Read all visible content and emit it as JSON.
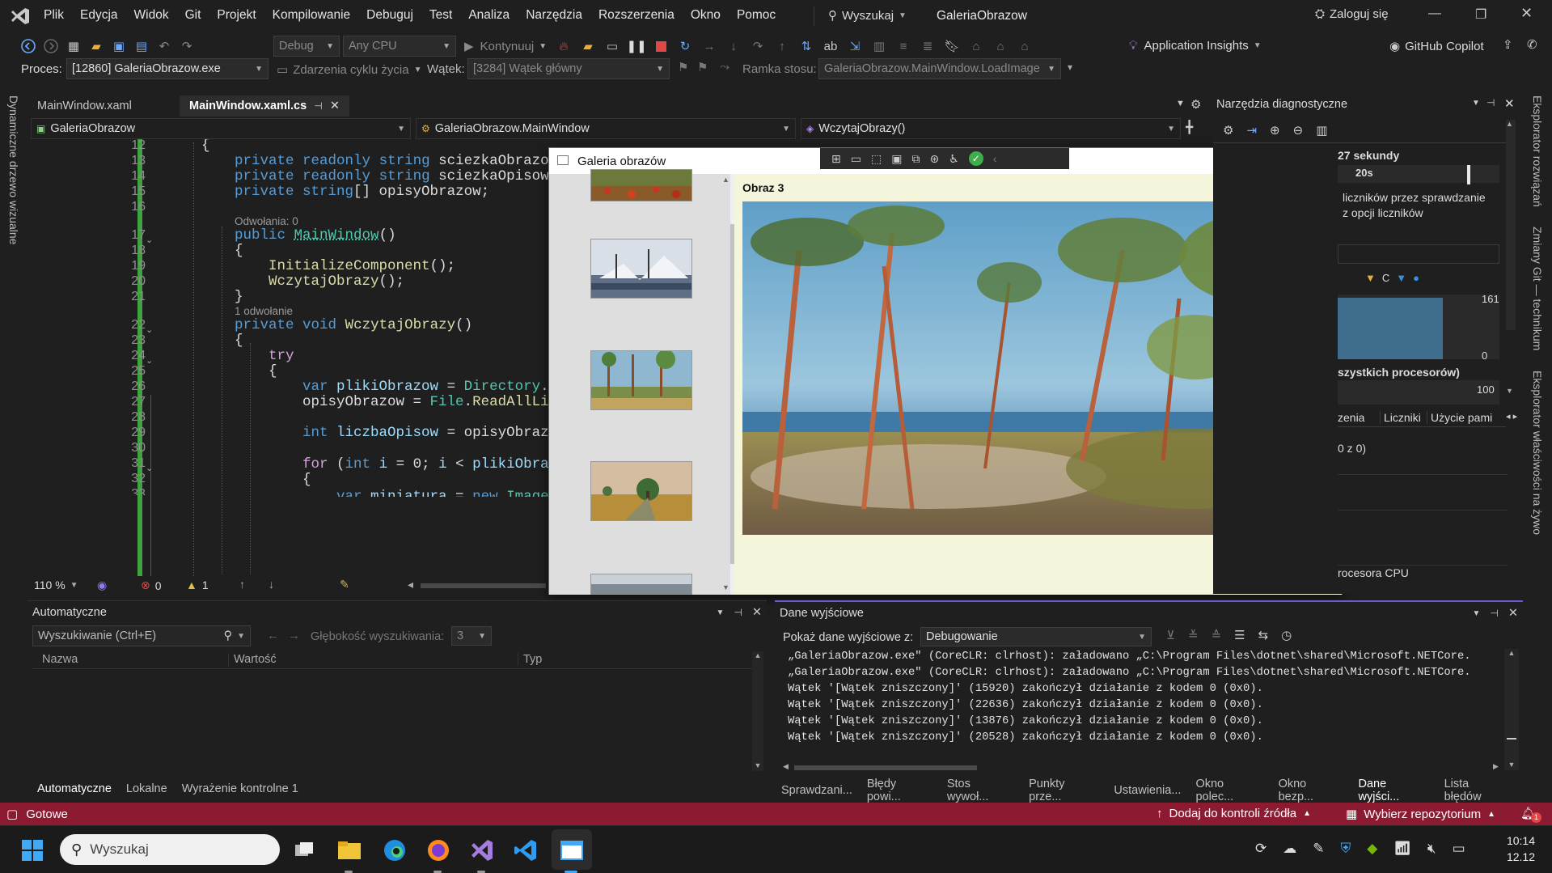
{
  "menu": {
    "items": [
      "Plik",
      "Edycja",
      "Widok",
      "Git",
      "Projekt",
      "Kompilowanie",
      "Debuguj",
      "Test",
      "Analiza",
      "Narzędzia",
      "Rozszerzenia",
      "Okno",
      "Pomoc"
    ],
    "search": "Wyszukaj",
    "solution": "GaleriaObrazow",
    "signin": "Zaloguj się"
  },
  "toolbar": {
    "config": "Debug",
    "platform": "Any CPU",
    "continue": "Kontynuuj",
    "insights": "Application Insights",
    "copilot": "GitHub Copilot",
    "process_label": "Proces:",
    "process_value": "[12860] GaleriaObrazow.exe",
    "lifecycle": "Zdarzenia cyklu życia",
    "thread_label": "Wątek:",
    "thread_value": "[3284] Wątek główny",
    "stackframe_label": "Ramka stosu:",
    "stackframe_value": "GaleriaObrazow.MainWindow.LoadImage"
  },
  "left_strip": {
    "label": "Dynamiczne drzewo wizualne"
  },
  "right_strip": {
    "labels": [
      "Eksplorator rozwiązań",
      "Zmiany Git — technikum",
      "Eksplorator właściwości na żywo"
    ]
  },
  "doc_tabs": [
    {
      "label": "MainWindow.xaml"
    },
    {
      "label": "MainWindow.xaml.cs"
    }
  ],
  "navbar": {
    "project": "GaleriaObrazow",
    "class": "GaleriaObrazow.MainWindow",
    "member": "WczytajObrazy()"
  },
  "editor": {
    "line_numbers": [
      "12",
      "13",
      "14",
      "15",
      "16",
      "17",
      "18",
      "19",
      "20",
      "21",
      "22",
      "23",
      "24",
      "25",
      "26",
      "27",
      "28",
      "29",
      "30",
      "31",
      "32",
      "33"
    ],
    "lens_refs_0": "Odwołania: 0",
    "lens_refs_1": "1 odwołanie",
    "zoom": "110 %",
    "errors": "0",
    "warnings": "1"
  },
  "app": {
    "title": "Galeria obrazów",
    "image_label": "Obraz 3"
  },
  "diag": {
    "title": "Narzędzia diagnostyczne",
    "time_fragment": "27 sekundy",
    "tick": "20s",
    "text1": "liczników przez sprawdzanie",
    "text2": "z opcji liczników",
    "legend_c": "C",
    "val_161": "161",
    "val_0": "0",
    "cpu_label": "szystkich procesorów)",
    "val_100": "100",
    "tabs": [
      "zenia",
      "Liczniki",
      "Użycie pami"
    ],
    "ratio": "0 z 0)",
    "cpu": "rocesora CPU"
  },
  "autos": {
    "title": "Automatyczne",
    "search_placeholder": "Wyszukiwanie (Ctrl+E)",
    "depth_label": "Głębokość wyszukiwania:",
    "depth_value": "3",
    "col_name": "Nazwa",
    "col_value": "Wartość",
    "col_type": "Typ",
    "tabs": [
      "Automatyczne",
      "Lokalne",
      "Wyrażenie kontrolne 1"
    ]
  },
  "output": {
    "title": "Dane wyjściowe",
    "show_from_label": "Pokaż dane wyjściowe z:",
    "show_from_value": "Debugowanie",
    "lines": [
      "„GaleriaObrazow.exe\" (CoreCLR: clrhost): załadowano „C:\\Program Files\\dotnet\\shared\\Microsoft.NETCore.App\\8.0.",
      "„GaleriaObrazow.exe\" (CoreCLR: clrhost): załadowano „C:\\Program Files\\dotnet\\shared\\Microsoft.NETCore.App\\8.0.",
      "Wątek '[Wątek zniszczony]' (15920) zakończył działanie z kodem 0 (0x0).",
      "Wątek '[Wątek zniszczony]' (22636) zakończył działanie z kodem 0 (0x0).",
      "Wątek '[Wątek zniszczony]' (13876) zakończył działanie z kodem 0 (0x0).",
      "Wątek '[Wątek zniszczony]' (20528) zakończył działanie z kodem 0 (0x0)."
    ],
    "tabs": [
      "Sprawdzani...",
      "Błędy powi...",
      "Stos wywoł...",
      "Punkty prze...",
      "Ustawienia...",
      "Okno polec...",
      "Okno bezp...",
      "Dane wyjści...",
      "Lista błędów"
    ]
  },
  "status": {
    "ready": "Gotowe",
    "source_control": "Dodaj do kontroli źródła",
    "repo": "Wybierz repozytorium",
    "notif_count": "1"
  },
  "taskbar": {
    "search_placeholder": "Wyszukaj",
    "time": "10:14",
    "date": "12.12"
  },
  "colors": {
    "status_bar": "#8c1b32",
    "accent": "#6b5bd2",
    "app_bg": "#f5f5dc"
  }
}
